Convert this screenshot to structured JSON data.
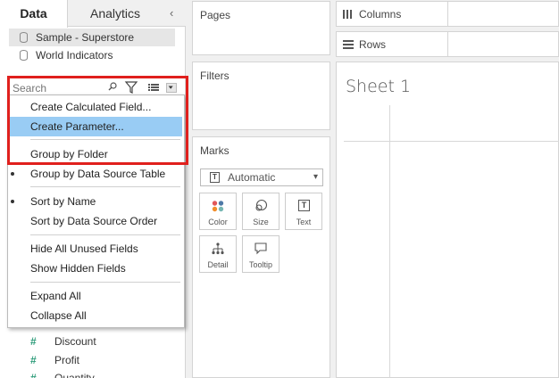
{
  "tabs": {
    "data": "Data",
    "analytics": "Analytics"
  },
  "data_sources": [
    "Sample - Superstore",
    "World Indicators"
  ],
  "search": {
    "placeholder": "Search"
  },
  "menu": {
    "items": [
      {
        "label": "Create Calculated Field...",
        "checked": false,
        "highlighted": false
      },
      {
        "label": "Create Parameter...",
        "checked": false,
        "highlighted": true
      },
      {
        "label": "Group by Folder",
        "checked": false,
        "highlighted": false
      },
      {
        "label": "Group by Data Source Table",
        "checked": true,
        "highlighted": false
      },
      {
        "label": "Sort by Name",
        "checked": true,
        "highlighted": false
      },
      {
        "label": "Sort by Data Source Order",
        "checked": false,
        "highlighted": false
      },
      {
        "label": "Hide All Unused Fields",
        "checked": false,
        "highlighted": false
      },
      {
        "label": "Show Hidden Fields",
        "checked": false,
        "highlighted": false
      },
      {
        "label": "Expand All",
        "checked": false,
        "highlighted": false
      },
      {
        "label": "Collapse All",
        "checked": false,
        "highlighted": false
      }
    ]
  },
  "fields": [
    {
      "icon": "#",
      "label": "Discount"
    },
    {
      "icon": "#",
      "label": "Profit"
    },
    {
      "icon": "#",
      "label": "Quantity"
    }
  ],
  "pages": {
    "title": "Pages"
  },
  "filters": {
    "title": "Filters"
  },
  "marks": {
    "title": "Marks",
    "type": "Automatic",
    "type_icon": "T",
    "buttons": [
      "Color",
      "Size",
      "Text",
      "Detail",
      "Tooltip"
    ],
    "text_icon": "T"
  },
  "shelves": {
    "columns": "Columns",
    "rows": "Rows"
  },
  "sheet": {
    "title": "Sheet 1"
  },
  "colors": {
    "highlight_box": "#e0201d",
    "menu_highlight": "#99ccf4",
    "measure_icon": "#2e9c7a"
  }
}
